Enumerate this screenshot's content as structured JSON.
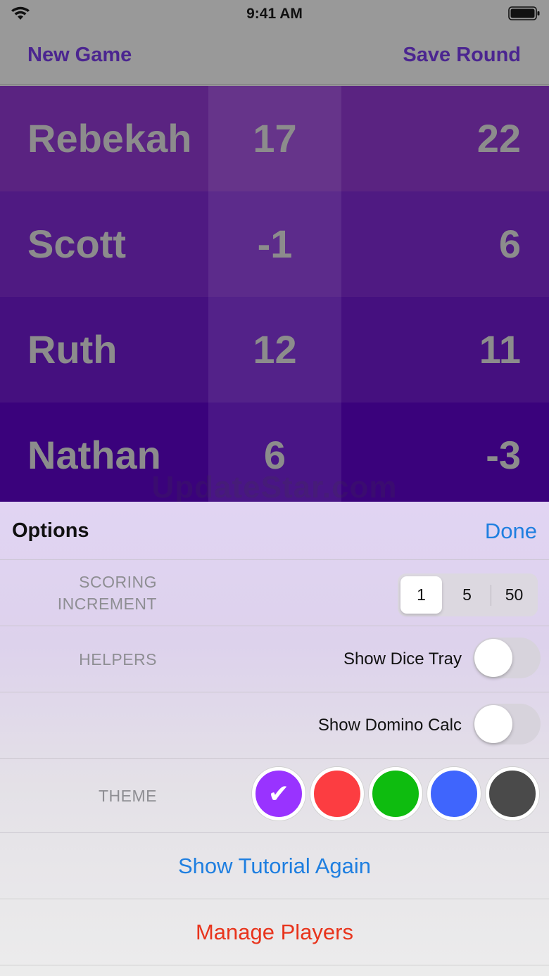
{
  "status_bar": {
    "time": "9:41 AM",
    "icons": [
      "wifi-icon",
      "battery-icon"
    ]
  },
  "nav": {
    "left_label": "New Game",
    "right_label": "Save Round"
  },
  "players": [
    {
      "name": "Rebekah",
      "round": "17",
      "total": "22",
      "bg": "#5a2381"
    },
    {
      "name": "Scott",
      "round": "-1",
      "total": "6",
      "bg": "#4f1a82"
    },
    {
      "name": "Ruth",
      "round": "12",
      "total": "11",
      "bg": "#45107f"
    },
    {
      "name": "Nathan",
      "round": "6",
      "total": "-3",
      "bg": "#3a027c"
    }
  ],
  "watermark": "UpdateStar.com",
  "options": {
    "title": "Options",
    "done_label": "Done",
    "scoring": {
      "label_line1": "SCORING",
      "label_line2": "INCREMENT",
      "segments": [
        "1",
        "5",
        "50"
      ],
      "selected": "1"
    },
    "helpers": {
      "label": "HELPERS",
      "dice_tray_label": "Show Dice Tray",
      "dice_tray_on": false,
      "domino_calc_label": "Show Domino Calc",
      "domino_calc_on": false
    },
    "theme": {
      "label": "THEME",
      "selected": "purple",
      "swatches": [
        {
          "name": "purple",
          "color": "#9933ff"
        },
        {
          "name": "red",
          "color": "#fc3d41"
        },
        {
          "name": "green",
          "color": "#0ebc0f"
        },
        {
          "name": "blue",
          "color": "#3f65fd"
        },
        {
          "name": "dark-gray",
          "color": "#4a4a4a"
        }
      ],
      "check_glyph": "✔"
    },
    "tutorial_label": "Show Tutorial Again",
    "manage_players_label": "Manage Players",
    "colors": {
      "link_blue": "#1f7fe0",
      "danger_red": "#e8341c"
    }
  }
}
